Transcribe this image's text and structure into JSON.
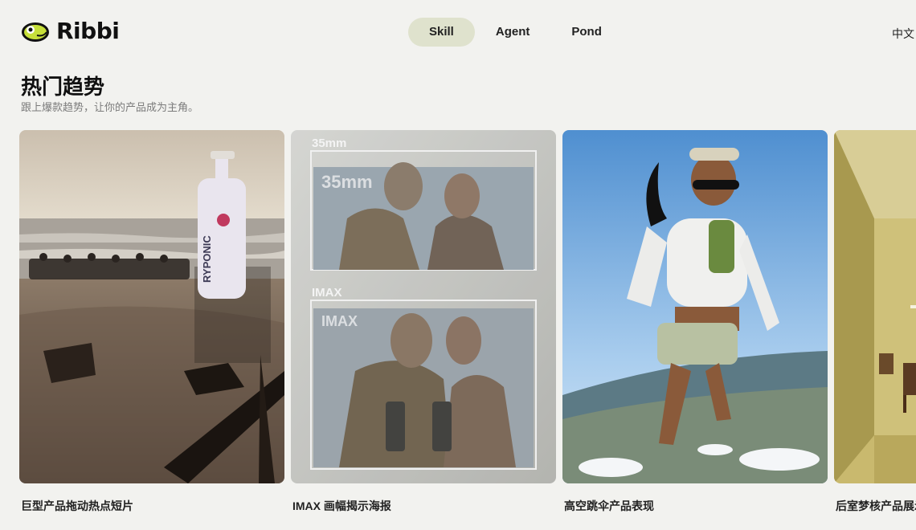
{
  "brand": {
    "name": "Ribbi"
  },
  "nav": {
    "items": [
      "Skill",
      "Agent",
      "Pond"
    ],
    "active": "Skill"
  },
  "lang": "中文",
  "section": {
    "title": "热门趋势",
    "subtitle": "跟上爆款趋势，让你的产品成为主角。"
  },
  "cards": [
    {
      "caption": "巨型产品拖动热点短片",
      "bottle_label": "RYPONIC"
    },
    {
      "caption": "IMAX 画幅揭示海报",
      "label_top": "35mm",
      "label_top_inner": "35mm",
      "label_bottom": "IMAX",
      "label_bottom_inner": "IMAX"
    },
    {
      "caption": "高空跳伞产品表现"
    },
    {
      "caption": "后室梦核产品展示"
    }
  ],
  "colors": {
    "accent": "#dfe2cd",
    "background": "#f2f2ef"
  }
}
